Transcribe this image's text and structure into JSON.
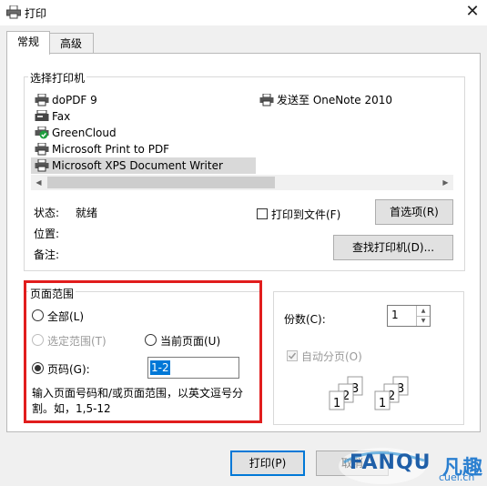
{
  "window": {
    "title": "打印"
  },
  "tabs": [
    {
      "label": "常规"
    },
    {
      "label": "高级"
    }
  ],
  "select_printer": {
    "legend": "选择打印机",
    "printers": [
      {
        "label": "doPDF 9"
      },
      {
        "label": "Fax"
      },
      {
        "label": "GreenCloud"
      },
      {
        "label": "Microsoft Print to PDF"
      },
      {
        "label": "Microsoft XPS Document Writer",
        "selected": true
      },
      {
        "label": "发送至 OneNote 2010"
      }
    ],
    "status_label": "状态:",
    "status_value": "就绪",
    "location_label": "位置:",
    "comment_label": "备注:",
    "print_to_file_label": "打印到文件(F)",
    "preferences_button": "首选项(R)",
    "find_printer_button": "查找打印机(D)..."
  },
  "page_range": {
    "legend": "页面范围",
    "all": "全部(L)",
    "selection": "选定范围(T)",
    "current_page": "当前页面(U)",
    "pages": "页码(G):",
    "pages_value": "1-2",
    "hint": "输入页面号码和/或页面范围，以英文逗号分割。如，1,5-12"
  },
  "copies": {
    "label": "份数(C):",
    "value": "1",
    "collate": "自动分页(O)"
  },
  "footer": {
    "print_button": "打印(P)",
    "cancel_button": "取消"
  },
  "watermark": {
    "brand": "FANQU",
    "brand_cn": "凡趣",
    "site": "cuel.cn"
  },
  "colors": {
    "accent": "#0078d7",
    "highlight_frame": "#e11d1d",
    "selection_bg": "#d9d9d9"
  }
}
